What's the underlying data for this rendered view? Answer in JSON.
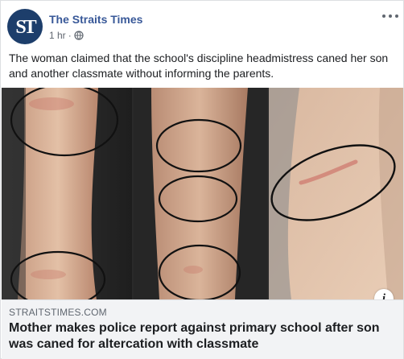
{
  "post": {
    "page_name": "The Straits Times",
    "avatar_text": "ST",
    "timestamp": "1 hr",
    "separator": "·",
    "privacy_icon": "globe-icon",
    "more_icon": "more-horizontal-icon",
    "text": "The woman claimed that the school's discipline headmistress caned her son and another classmate without informing the parents."
  },
  "link": {
    "domain": "STRAITSTIMES.COM",
    "headline": "Mother makes police report against primary school after son was caned for altercation with classmate",
    "info_icon": "info-icon",
    "info_label": "i"
  },
  "colors": {
    "page_name": "#385898",
    "meta": "#606770",
    "text": "#1c1e21",
    "link_bg": "#f2f3f5",
    "avatar_bg": "#1d3e6b"
  }
}
